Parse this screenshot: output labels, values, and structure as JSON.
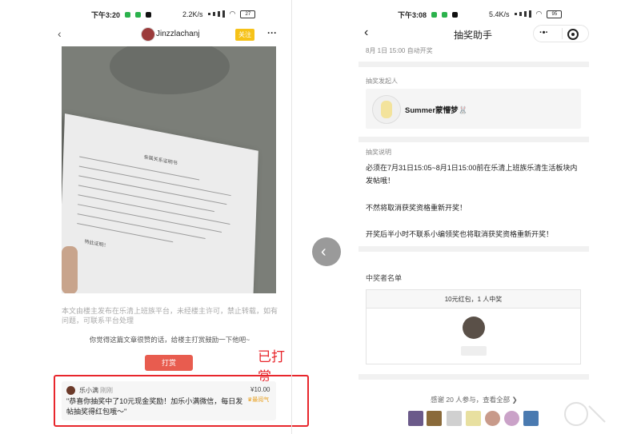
{
  "left_screen": {
    "status_bar": {
      "time": "下午3:20",
      "speed": "2.2K/s",
      "battery": "27"
    },
    "nav": {
      "back_icon": "chevron-left-icon",
      "username": "Jinzzlachanj",
      "follow_label": "关注",
      "more_label": "···"
    },
    "image": {
      "doc_title": "亲属关系证明书",
      "stamp": "特此证明！"
    },
    "notice": "本文由楼主发布在乐清上班族平台，未经楼主许可，禁止转载，如有问题，可联系平台处理",
    "appreciate_text": "你觉得这篇文章很赞的话，给楼主打赏鼓励一下他吧~",
    "reward_button": "打赏",
    "annotation": "已打赏",
    "reward_card": {
      "name": "乐小满",
      "time": "刚刚",
      "amount": "¥10.00",
      "badge": "最阅气",
      "message": "\"恭喜你抽奖中了10元现金奖励！加乐小满微信，每日发帖抽奖得红包哦～\""
    }
  },
  "right_screen": {
    "status_bar": {
      "time": "下午3:08",
      "speed": "5.4K/s",
      "battery": "95"
    },
    "nav": {
      "back_icon": "chevron-left-icon",
      "title": "抽奖助手",
      "more_label": "·•·",
      "target_icon": "target-icon"
    },
    "draw_time": "8月 1日 15:00 自动开奖",
    "initiator": {
      "label": "抽奖发起人",
      "name": "Summer蒙懵梦🐰"
    },
    "description": {
      "label": "抽奖说明",
      "p1": "必须在7月31日15:05~8月1日15:00前在乐清上班族乐清生活板块内发帖哦！",
      "p2": "不然将取消获奖资格重新开奖！",
      "p3": "开奖后半小时不联系小编领奖也将取消获奖资格重新开奖！"
    },
    "winners": {
      "label": "中奖者名单",
      "prize": "10元红包，1 人中奖"
    },
    "footer": "感谢 20 人参与，查看全部 ❯"
  },
  "colors": {
    "accent_red": "#e8262c",
    "button_red": "#e85c4f",
    "follow_yellow": "#f6c218"
  }
}
